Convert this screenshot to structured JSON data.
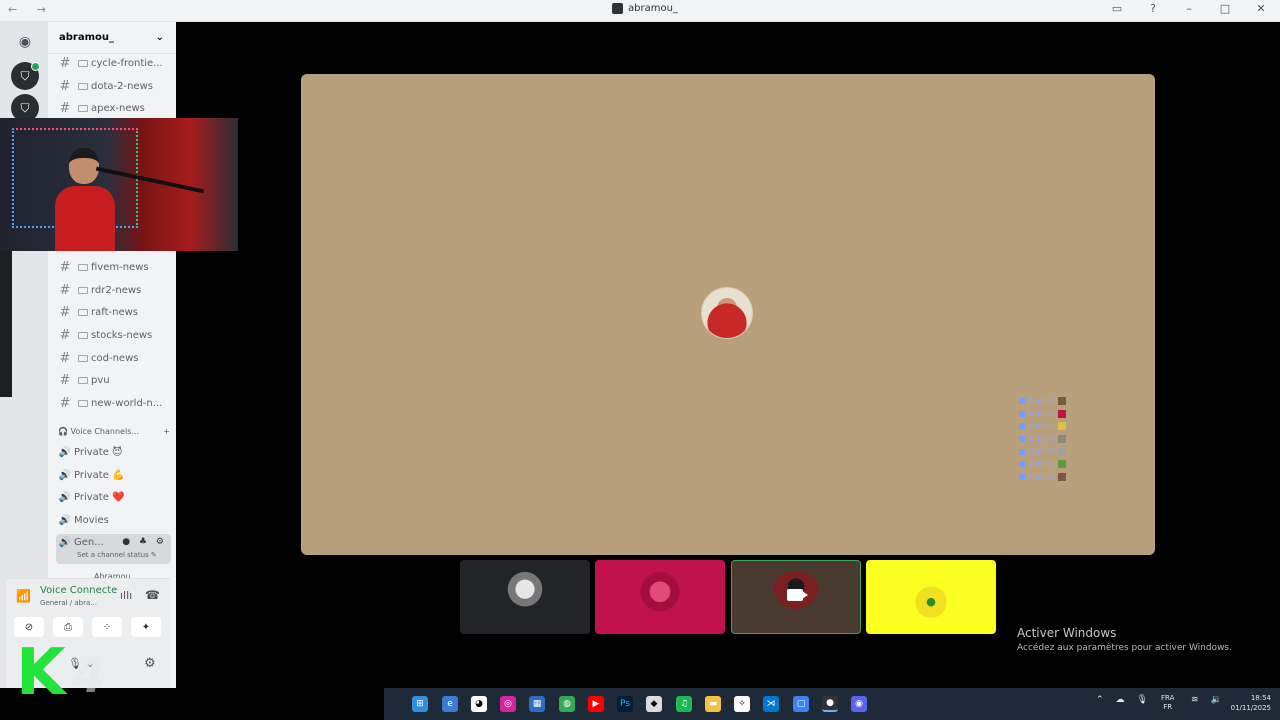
{
  "window": {
    "title": "abramou_",
    "nav_label": "← →"
  },
  "guild": {
    "name": "abramou_"
  },
  "channels": [
    {
      "label": "cycle-frontie..."
    },
    {
      "label": "dota-2-news"
    },
    {
      "label": "apex-news"
    },
    {
      "label": "fivem-news"
    },
    {
      "label": "rdr2-news"
    },
    {
      "label": "raft-news"
    },
    {
      "label": "stocks-news"
    },
    {
      "label": "cod-news"
    },
    {
      "label": "pvu"
    },
    {
      "label": "new-world-n..."
    }
  ],
  "voice_category": {
    "label": "Voice Channels...",
    "add": "+"
  },
  "voice_channels": [
    {
      "label": "Private 😈"
    },
    {
      "label": "Private 💪"
    },
    {
      "label": "Private ❤️"
    },
    {
      "label": "Movies"
    }
  ],
  "active_channel": {
    "label": "Gen...",
    "sub": "Set a channel status ✎",
    "member": "Abramou"
  },
  "voice_panel": {
    "status": "Voice Connecte",
    "sub": "General / abra..."
  },
  "chat_overlay": {
    "lines": [
      "Arabia7",
      "Arabia7",
      "Arabia7",
      "Arabia7",
      "Arabia7",
      "Arabia7",
      "Arabia7"
    ]
  },
  "activate_windows": {
    "title": "Activer Windows",
    "subtitle": "Accédez aux paramètres pour activer Windows."
  },
  "k4_logo": {
    "k": "K",
    "n": "4"
  },
  "taskbar": {
    "lang_top": "FRA",
    "lang_bottom": "FR",
    "time": "18:54",
    "date": "01/11/2025"
  },
  "colors": {
    "stage_bg": "#b9a07d",
    "tile2_bg": "#c2124e",
    "tile4_bg": "#fbff1f",
    "voice_connected": "#248046",
    "k4_green": "#22e33a"
  }
}
